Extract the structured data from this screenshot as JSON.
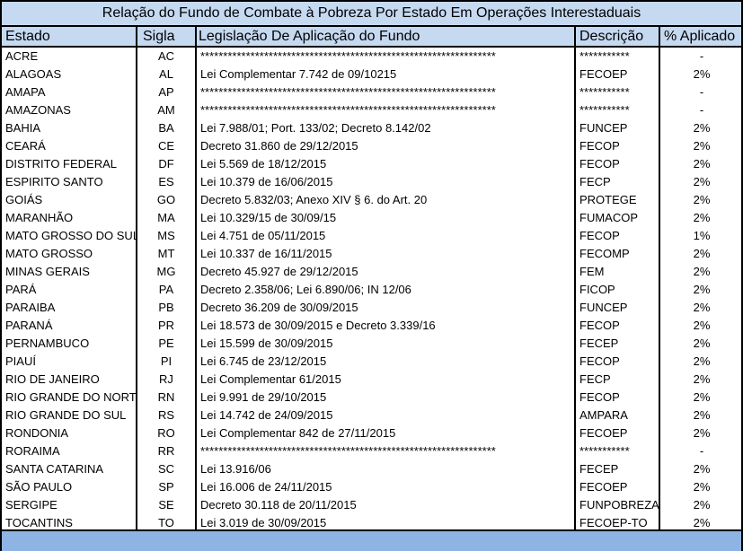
{
  "title": "Relação do Fundo de Combate à Pobreza Por Estado  Em Operações Interestaduais",
  "headers": {
    "estado": "Estado",
    "sigla": "Sigla",
    "legislacao": "Legislação De Aplicação do Fundo",
    "descricao": "Descrição",
    "aplicado": "% Aplicado"
  },
  "colors": {
    "header_bg": "#c5d9f1",
    "footer_bg": "#8db4e2",
    "border": "#000000"
  },
  "rows": [
    {
      "estado": "ACRE",
      "sigla": "AC",
      "legislacao": "*****************************************************************",
      "descricao": "***********",
      "aplicado": "-"
    },
    {
      "estado": "ALAGOAS",
      "sigla": "AL",
      "legislacao": "Lei Complementar 7.742 de 09/10215",
      "descricao": "FECOEP",
      "aplicado": "2%"
    },
    {
      "estado": "AMAPA",
      "sigla": "AP",
      "legislacao": "*****************************************************************",
      "descricao": "***********",
      "aplicado": "-"
    },
    {
      "estado": "AMAZONAS",
      "sigla": "AM",
      "legislacao": "*****************************************************************",
      "descricao": "***********",
      "aplicado": "-"
    },
    {
      "estado": "BAHIA",
      "sigla": "BA",
      "legislacao": "Lei 7.988/01; Port. 133/02; Decreto 8.142/02",
      "descricao": "FUNCEP",
      "aplicado": "2%"
    },
    {
      "estado": "CEARÁ",
      "sigla": "CE",
      "legislacao": "Decreto 31.860 de 29/12/2015",
      "descricao": "FECOP",
      "aplicado": "2%"
    },
    {
      "estado": "DISTRITO FEDERAL",
      "sigla": "DF",
      "legislacao": "Lei 5.569 de 18/12/2015",
      "descricao": "FECOP",
      "aplicado": "2%"
    },
    {
      "estado": "ESPIRITO SANTO",
      "sigla": "ES",
      "legislacao": "Lei 10.379 de 16/06/2015",
      "descricao": "FECP",
      "aplicado": "2%"
    },
    {
      "estado": "GOIÁS",
      "sigla": "GO",
      "legislacao": "Decreto 5.832/03; Anexo XIV § 6. do Art. 20",
      "descricao": "PROTEGE",
      "aplicado": "2%"
    },
    {
      "estado": "MARANHÃO",
      "sigla": "MA",
      "legislacao": "Lei 10.329/15 de 30/09/15",
      "descricao": "FUMACOP",
      "aplicado": "2%"
    },
    {
      "estado": "MATO GROSSO DO SUL",
      "sigla": "MS",
      "legislacao": "Lei 4.751 de 05/11/2015",
      "descricao": "FECOP",
      "aplicado": "1%"
    },
    {
      "estado": "MATO GROSSO",
      "sigla": "MT",
      "legislacao": "Lei 10.337 de 16/11/2015",
      "descricao": "FECOMP",
      "aplicado": "2%"
    },
    {
      "estado": "MINAS GERAIS",
      "sigla": "MG",
      "legislacao": "Decreto 45.927 de 29/12/2015",
      "descricao": "FEM",
      "aplicado": "2%"
    },
    {
      "estado": "PARÁ",
      "sigla": "PA",
      "legislacao": "Decreto 2.358/06; Lei 6.890/06; IN 12/06",
      "descricao": "FICOP",
      "aplicado": "2%"
    },
    {
      "estado": "PARAIBA",
      "sigla": "PB",
      "legislacao": "Decreto 36.209 de 30/09/2015",
      "descricao": "FUNCEP",
      "aplicado": "2%"
    },
    {
      "estado": "PARANÁ",
      "sigla": "PR",
      "legislacao": "Lei 18.573 de 30/09/2015  e Decreto 3.339/16",
      "descricao": "FECOP",
      "aplicado": "2%"
    },
    {
      "estado": "PERNAMBUCO",
      "sigla": "PE",
      "legislacao": "Lei 15.599 de 30/09/2015",
      "descricao": "FECEP",
      "aplicado": "2%"
    },
    {
      "estado": "PIAUÍ",
      "sigla": "PI",
      "legislacao": "Lei 6.745 de 23/12/2015",
      "descricao": "FECOP",
      "aplicado": "2%"
    },
    {
      "estado": "RIO DE JANEIRO",
      "sigla": "RJ",
      "legislacao": "Lei Complementar 61/2015",
      "descricao": "FECP",
      "aplicado": "2%"
    },
    {
      "estado": "RIO GRANDE DO NORTE",
      "sigla": "RN",
      "legislacao": "Lei 9.991 de 29/10/2015",
      "descricao": "FECOP",
      "aplicado": "2%"
    },
    {
      "estado": "RIO GRANDE DO SUL",
      "sigla": "RS",
      "legislacao": "Lei 14.742 de 24/09/2015",
      "descricao": "AMPARA",
      "aplicado": "2%"
    },
    {
      "estado": "RONDONIA",
      "sigla": "RO",
      "legislacao": "Lei Complementar 842 de 27/11/2015",
      "descricao": "FECOEP",
      "aplicado": "2%"
    },
    {
      "estado": "RORAIMA",
      "sigla": "RR",
      "legislacao": "*****************************************************************",
      "descricao": "***********",
      "aplicado": "-"
    },
    {
      "estado": "SANTA CATARINA",
      "sigla": "SC",
      "legislacao": "Lei 13.916/06",
      "descricao": "FECEP",
      "aplicado": "2%"
    },
    {
      "estado": "SÃO PAULO",
      "sigla": "SP",
      "legislacao": "Lei 16.006 de 24/11/2015",
      "descricao": "FECOEP",
      "aplicado": "2%"
    },
    {
      "estado": "SERGIPE",
      "sigla": "SE",
      "legislacao": "Decreto 30.118 de 20/11/2015",
      "descricao": "FUNPOBREZA",
      "aplicado": "2%"
    },
    {
      "estado": "TOCANTINS",
      "sigla": "TO",
      "legislacao": "Lei 3.019 de 30/09/2015",
      "descricao": "FECOEP-TO",
      "aplicado": "2%"
    }
  ]
}
